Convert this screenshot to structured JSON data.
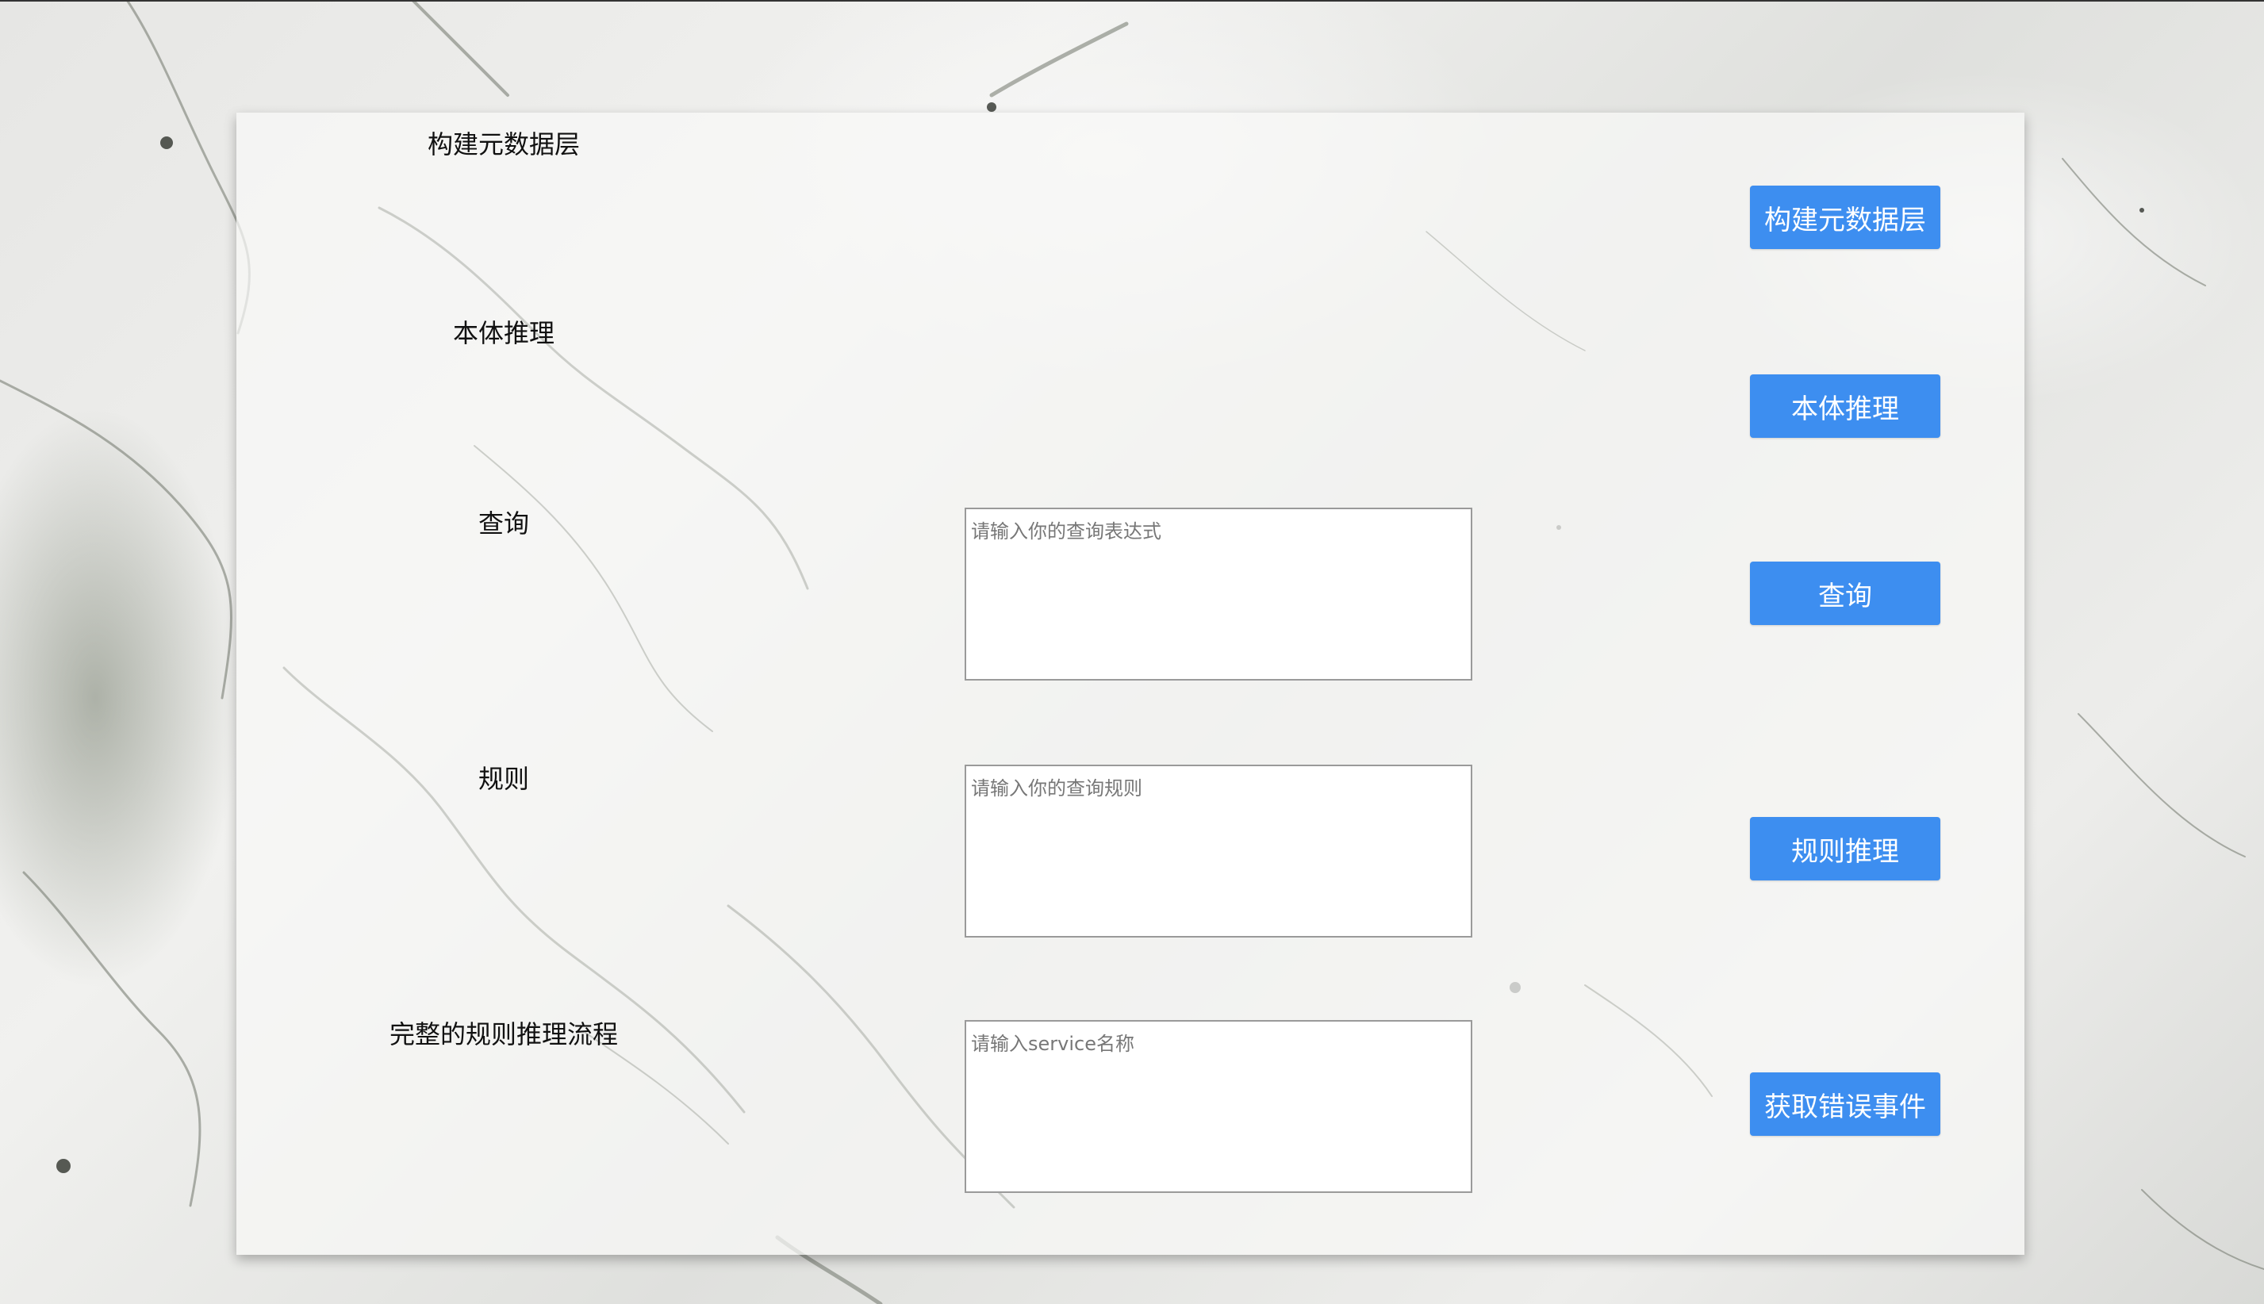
{
  "rows": [
    {
      "label": "构建元数据层",
      "button": "构建元数据层"
    },
    {
      "label": "本体推理",
      "button": "本体推理"
    },
    {
      "label": "查询",
      "placeholder": "请输入你的查询表达式",
      "button": "查询"
    },
    {
      "label": "规则",
      "placeholder": "请输入你的查询规则",
      "button": "规则推理"
    },
    {
      "label": "完整的规则推理流程",
      "placeholder": "请输入service名称",
      "button": "获取错误事件"
    }
  ],
  "colors": {
    "button_bg": "#3d8ef0",
    "button_text": "#ffffff",
    "label_text": "#111111"
  }
}
